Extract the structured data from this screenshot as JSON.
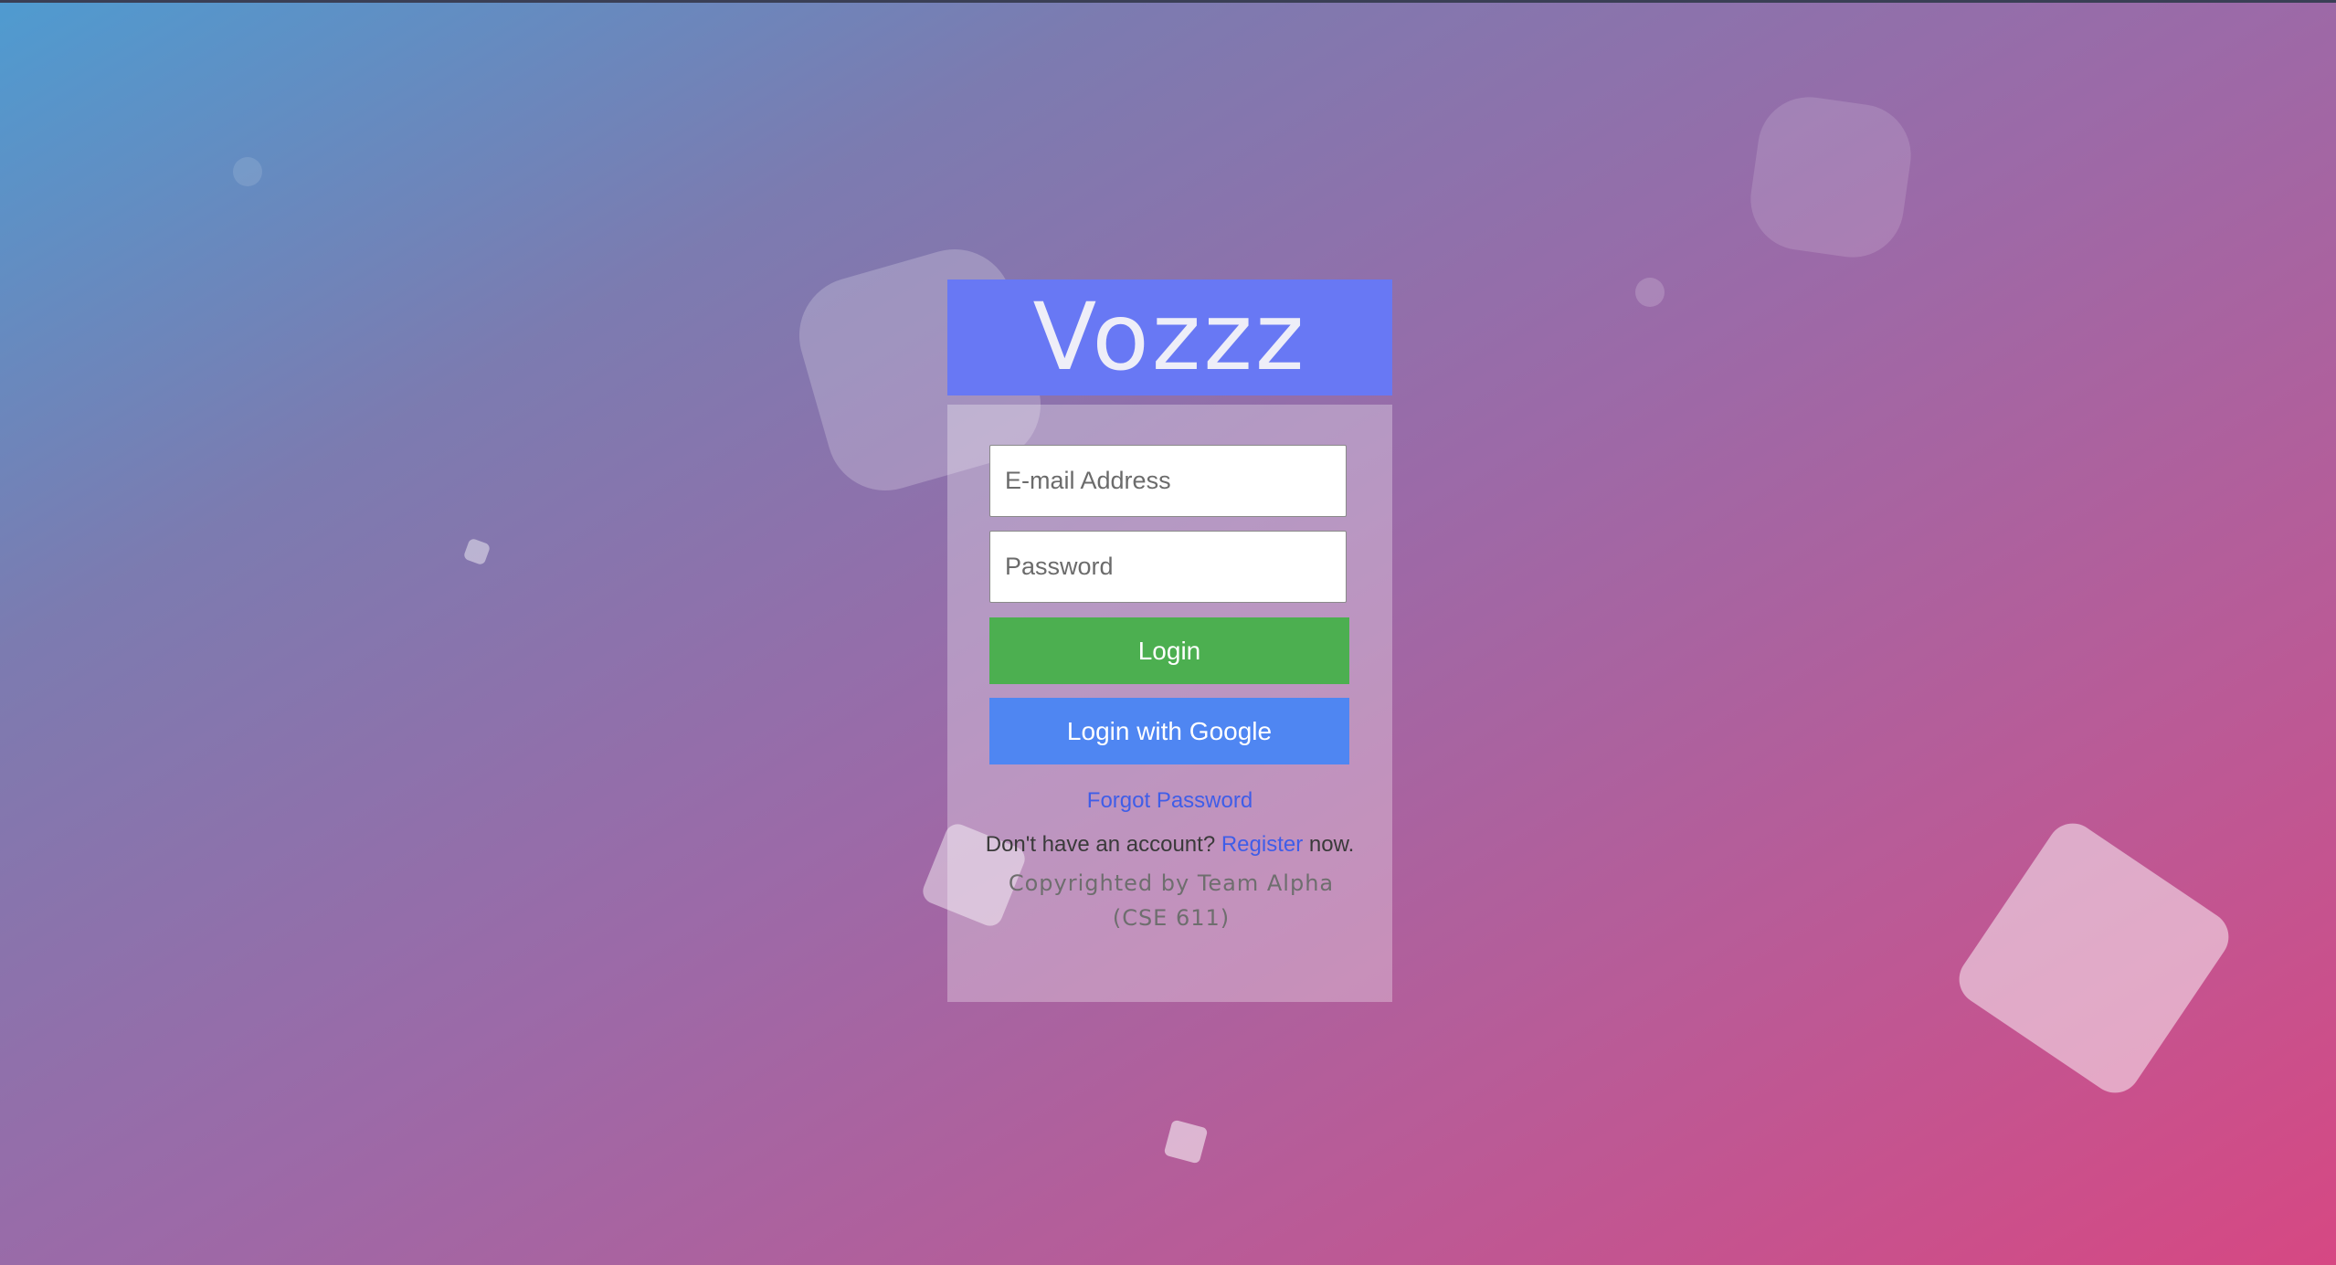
{
  "app": {
    "brand": "Vozzz"
  },
  "login_form": {
    "email_placeholder": "E-mail Address",
    "password_placeholder": "Password",
    "login_button": "Login",
    "google_button": "Login with Google",
    "forgot_password": "Forgot Password",
    "register_prefix": "Don't have an account?",
    "register_link": "Register",
    "register_suffix": "now.",
    "copyright": "Copyrighted by Team Alpha (CSE 611)"
  },
  "colors": {
    "brand_header": "#6878f4",
    "login_button": "#4caf50",
    "google_button": "#4f86f2",
    "link": "#3f5de8"
  }
}
